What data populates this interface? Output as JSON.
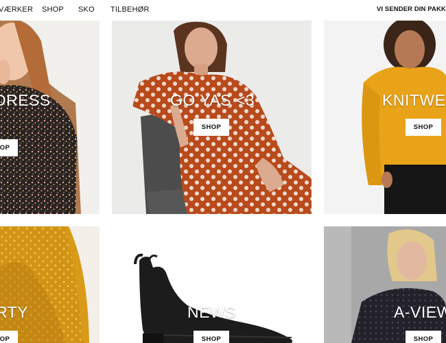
{
  "nav": {
    "items": [
      "VÆRKER",
      "SHOP",
      "SKO",
      "TILBEHØR"
    ],
    "promo": "VI SENDER DIN PAKKE I"
  },
  "tiles": [
    {
      "title": "DRESS",
      "button": "SHOP",
      "image": "model-in-floral-dress"
    },
    {
      "title": "GO YAS <3",
      "button": "SHOP",
      "image": "model-in-orange-polka-dot-dress-on-chair"
    },
    {
      "title": "KNITWEA",
      "button": "SHOP",
      "image": "model-in-yellow-knit-sweater"
    },
    {
      "title": "RTY",
      "button": "SHOP",
      "image": "mustard-dotted-party-dress"
    },
    {
      "title": "NEWS",
      "button": "SHOP",
      "image": "black-croc-ankle-boot"
    },
    {
      "title": "A-VIEW",
      "button": "SHOP",
      "image": "model-in-black-lace-top"
    }
  ],
  "colors": {
    "tile_bg_light": "#f3f3f3",
    "orange_dress": "#b84a1c",
    "mustard": "#e8a318",
    "button_bg": "#ffffff"
  }
}
